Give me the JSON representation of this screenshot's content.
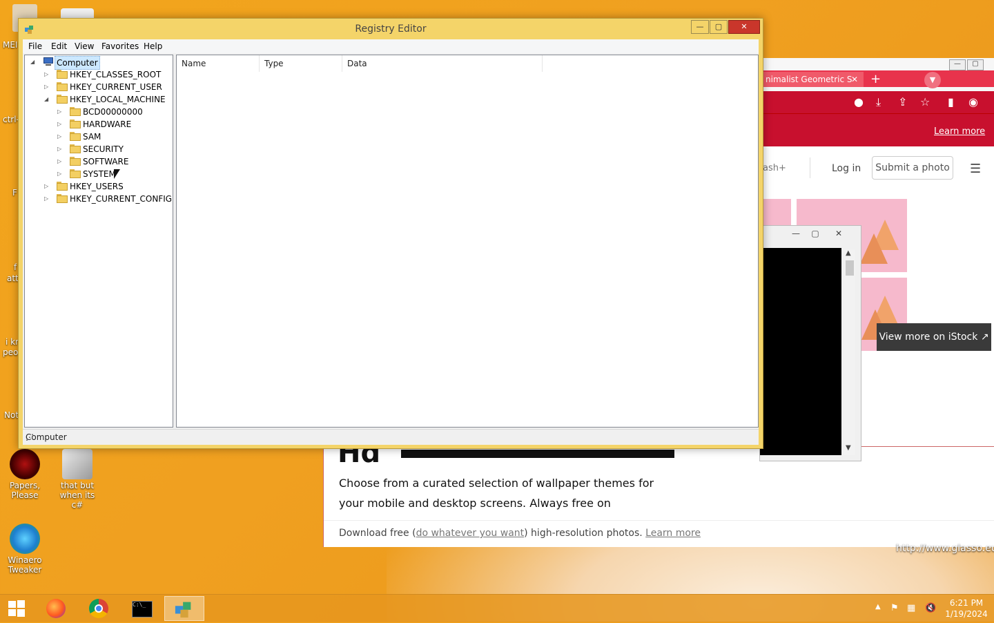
{
  "desktop": {
    "icons": [
      {
        "label_line1": "Papers,",
        "label_line2": "Please"
      },
      {
        "label_line1": "that but",
        "label_line2": "when its c#"
      },
      {
        "label_line1": "Winaero",
        "label_line2": "Tweaker"
      }
    ],
    "edge_labels": [
      "MEI",
      "ctrl-",
      "F",
      "f",
      "att",
      "i kn",
      "peo",
      "Not"
    ],
    "url_text": "http://www.glasso.eu"
  },
  "browser": {
    "tab_title": "nimalist Geometric S",
    "tab_close": "✕",
    "new_tab": "+",
    "banner_link": "Learn more",
    "nav_partial": "ash+",
    "login": "Log in",
    "submit": "Submit a photo",
    "istock": "View more on iStock ↗"
  },
  "page": {
    "heading_partial": "Hd",
    "paragraph": "Choose from a curated selection of wallpaper themes for your mobile and desktop screens. Always free on",
    "strip_prefix": "Download free (",
    "strip_link": "do whatever you want",
    "strip_mid": ") high-resolution photos. ",
    "strip_learn": "Learn more"
  },
  "regedit": {
    "title": "Registry Editor",
    "menu": [
      "File",
      "Edit",
      "View",
      "Favorites",
      "Help"
    ],
    "columns": [
      "Name",
      "Type",
      "Data"
    ],
    "status": "Computer",
    "tree": {
      "root": "Computer",
      "hives": [
        "HKEY_CLASSES_ROOT",
        "HKEY_CURRENT_USER",
        "HKEY_LOCAL_MACHINE",
        "HKEY_USERS",
        "HKEY_CURRENT_CONFIG"
      ],
      "hklm_children": [
        "BCD00000000",
        "HARDWARE",
        "SAM",
        "SECURITY",
        "SOFTWARE",
        "SYSTEM"
      ]
    }
  },
  "taskbar": {
    "time": "6:21 PM",
    "date": "1/19/2024"
  }
}
